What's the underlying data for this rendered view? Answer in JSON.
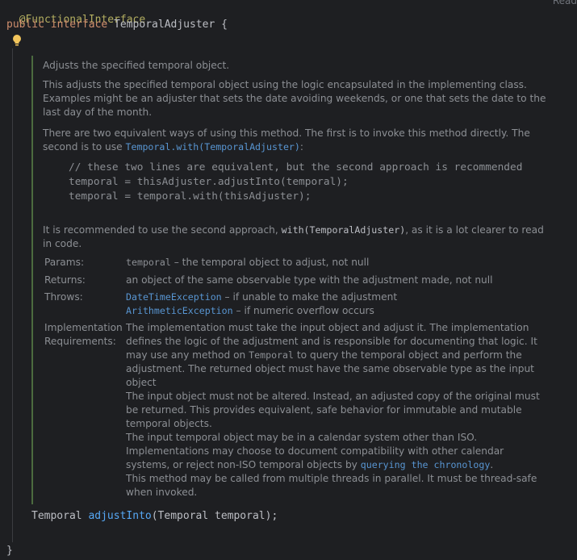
{
  "editor": {
    "top_right_label": "Read",
    "annotation": "@FunctionalInterface",
    "decl": {
      "kw_public": "public",
      "kw_interface": "interface",
      "name": "TemporalAdjuster",
      "open_brace": "{"
    },
    "bottom_decl": {
      "return_type": "Temporal",
      "method_name": "adjustInto",
      "params": "(Temporal temporal);"
    },
    "close_brace": "}"
  },
  "doc": {
    "summary": "Adjusts the specified temporal object.",
    "description": "This adjusts the specified temporal object using the logic encapsulated in the implementing class. Examples might be an adjuster that sets the date avoiding weekends, or one that sets the date to the last day of the month.",
    "ways_text": "There are two equivalent ways of using this method. The first is to invoke this method directly. The second is to use",
    "ways_link": "Temporal.with(TemporalAdjuster)",
    "ways_end": ":",
    "code_example": [
      "// these two lines are equivalent, but the second approach is recommended",
      "temporal = thisAdjuster.adjustInto(temporal);",
      "temporal = temporal.with(thisAdjuster);"
    ],
    "recommend_pre": "It is recommended to use the second approach,",
    "recommend_code": "with(TemporalAdjuster)",
    "recommend_post": ", as it is a lot clearer to read in code.",
    "params_label": "Params:",
    "params_code": "temporal",
    "params_text": " – the temporal object to adjust, not null",
    "returns_label": "Returns:",
    "returns_text": "an object of the same observable type with the adjustment made, not null",
    "throws_label": "Throws:",
    "throws": [
      {
        "exception": "DateTimeException",
        "text": " – if unable to make the adjustment"
      },
      {
        "exception": "ArithmeticException",
        "text": " – if numeric overflow occurs"
      }
    ],
    "impl_label_1": "Implementation",
    "impl_label_2": "Requirements:",
    "impl_p1_a": "The implementation must take the input object and adjust it. The implementation defines the logic of the adjustment and is responsible for documenting that logic. It may use any method on",
    "impl_p1_code": "Temporal",
    "impl_p1_b": "to query the temporal object and perform the adjustment. The returned object must have the same observable type as the input object",
    "impl_p2": "The input object must not be altered. Instead, an adjusted copy of the original must be returned. This provides equivalent, safe behavior for immutable and mutable temporal objects.",
    "impl_p3_a": "The input temporal object may be in a calendar system other than ISO. Implementations may choose to document compatibility with other calendar systems, or reject non-ISO temporal objects by",
    "impl_p3_link": "querying the chronology",
    "impl_p3_b": ".",
    "impl_p4": "This method may be called from multiple threads in parallel. It must be thread-safe when invoked."
  }
}
